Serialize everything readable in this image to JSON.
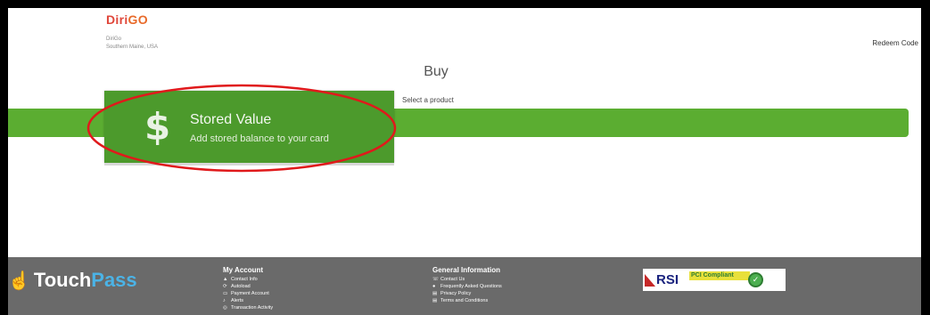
{
  "header": {
    "logo_text": "Diri",
    "logo_go": "GO",
    "org_line1": "DiriGo",
    "org_line2": "Southern Maine, USA",
    "redeem_label": "Redeem Code"
  },
  "main": {
    "title": "Buy",
    "select_label": "Select a product",
    "product": {
      "icon": "$",
      "icon_name": "dollar-icon",
      "title": "Stored Value",
      "subtitle": "Add stored balance to your card"
    }
  },
  "colors": {
    "accent_green": "#5bad31",
    "card_green": "#4c9a2c",
    "footer_gray": "#6a6a6a",
    "annotation_red": "#e0191b"
  },
  "footer": {
    "brand_touch": "Touch",
    "brand_pass": "Pass",
    "my_account": {
      "heading": "My Account",
      "items": [
        {
          "icon": "user-icon",
          "glyph": "▲",
          "label": "Contact Info"
        },
        {
          "icon": "autoload-icon",
          "glyph": "⟳",
          "label": "Autoload"
        },
        {
          "icon": "card-icon",
          "glyph": "▭",
          "label": "Payment Account"
        },
        {
          "icon": "bell-icon",
          "glyph": "♪",
          "label": "Alerts"
        },
        {
          "icon": "activity-icon",
          "glyph": "◎",
          "label": "Transaction Activity"
        }
      ]
    },
    "general_info": {
      "heading": "General Information",
      "items": [
        {
          "icon": "phone-icon",
          "glyph": "☏",
          "label": "Contact Us"
        },
        {
          "icon": "question-icon",
          "glyph": "●",
          "label": "Frequently Asked Questions"
        },
        {
          "icon": "document-icon",
          "glyph": "▤",
          "label": "Privacy Policy"
        },
        {
          "icon": "document-icon",
          "glyph": "▤",
          "label": "Terms and Conditions"
        }
      ]
    },
    "badge": {
      "rsi_text": "RSI",
      "pci_text": "PCI Compliant"
    }
  }
}
